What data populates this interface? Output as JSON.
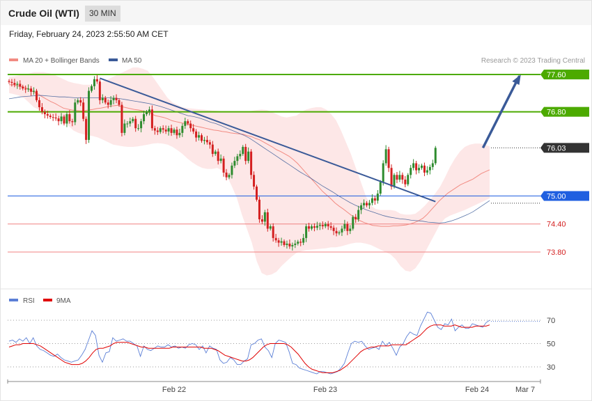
{
  "header": {
    "title": "Crude Oil (WTI)",
    "timeframe": "30 MIN"
  },
  "timestamp": "Friday, February 24, 2023 2:55:50 AM CET",
  "legend": {
    "ma20": {
      "label": "MA 20 + Bollinger Bands",
      "color": "#f28b82"
    },
    "ma50": {
      "label": "MA 50",
      "color": "#3a5a98"
    }
  },
  "credit": "Research © 2023 Trading Central",
  "rsi_legend": {
    "rsi": {
      "label": "RSI",
      "color": "#5b7fd6"
    },
    "ma9": {
      "label": "9MA",
      "color": "#e00000"
    }
  },
  "levels": [
    {
      "value": 77.6,
      "label": "77.60",
      "type": "resistance",
      "color": "#4caa00"
    },
    {
      "value": 76.8,
      "label": "76.80",
      "type": "resistance",
      "color": "#4caa00"
    },
    {
      "value": 76.03,
      "label": "76.03",
      "type": "last",
      "color": "#333333"
    },
    {
      "value": 75.0,
      "label": "75.00",
      "type": "pivot",
      "color": "#1f5fe0"
    },
    {
      "value": 74.4,
      "label": "74.40",
      "type": "support",
      "color": "#f08080"
    },
    {
      "value": 73.8,
      "label": "73.80",
      "type": "support",
      "color": "#f08080"
    }
  ],
  "x_labels": [
    "Feb 22",
    "Feb 23",
    "Feb 24",
    "Mar 7"
  ],
  "rsi_levels": [
    {
      "value": 70,
      "label": "70"
    },
    {
      "value": 50,
      "label": "50"
    },
    {
      "value": 30,
      "label": "30"
    }
  ],
  "chart_data": [
    {
      "type": "candlestick",
      "ylim": [
        73.1,
        77.8
      ],
      "close": [
        77.44,
        77.42,
        77.38,
        77.4,
        77.34,
        77.3,
        77.28,
        77.3,
        77.23,
        77.25,
        77.05,
        76.9,
        76.8,
        76.75,
        76.72,
        76.69,
        76.68,
        76.66,
        76.6,
        76.7,
        76.55,
        76.75,
        76.6,
        76.58,
        77.0,
        77.05,
        77.0,
        76.65,
        76.2,
        77.25,
        77.35,
        77.5,
        77.45,
        77.05,
        77.1,
        77.0,
        76.95,
        77.05,
        77.1,
        77.05,
        76.95,
        76.35,
        76.55,
        76.55,
        76.6,
        76.65,
        76.45,
        76.45,
        76.6,
        76.75,
        76.8,
        76.85,
        76.45,
        76.4,
        76.37,
        76.45,
        76.42,
        76.38,
        76.45,
        76.35,
        76.42,
        76.3,
        76.35,
        76.5,
        76.6,
        76.55,
        76.45,
        76.38,
        76.25,
        76.3,
        76.18,
        76.2,
        76.15,
        76.1,
        75.9,
        75.95,
        75.75,
        75.8,
        75.5,
        75.4,
        75.45,
        75.65,
        75.75,
        75.85,
        75.9,
        76.05,
        75.75,
        75.95,
        75.45,
        75.2,
        74.92,
        74.5,
        74.45,
        74.65,
        74.3,
        74.35,
        74.1,
        74.05,
        74.0,
        74.03,
        73.95,
        73.98,
        73.92,
        73.95,
        73.98,
        74.02,
        74.0,
        74.1,
        74.35,
        74.3,
        74.35,
        74.32,
        74.36,
        74.38,
        74.35,
        74.4,
        74.35,
        74.32,
        74.25,
        74.2,
        74.22,
        74.3,
        74.4,
        74.25,
        74.3,
        74.55,
        74.5,
        74.7,
        74.8,
        74.85,
        74.8,
        74.85,
        74.95,
        74.9,
        75.05,
        75.3,
        75.7,
        76.0,
        75.6,
        75.2,
        75.45,
        75.35,
        75.45,
        75.35,
        75.25,
        75.45,
        75.6,
        75.7,
        75.55,
        75.6,
        75.65,
        75.5,
        75.55,
        75.62,
        75.7,
        76.03
      ],
      "ma20": [
        77.38,
        77.38,
        77.36,
        77.34,
        77.32,
        77.27,
        77.22,
        77.18,
        77.12,
        77.07,
        77.02,
        76.98,
        76.93,
        76.88,
        76.86,
        76.84,
        76.83,
        76.82,
        76.82,
        76.84,
        76.85,
        76.87,
        76.88,
        76.9,
        76.92,
        76.93,
        76.94,
        76.91,
        76.89,
        76.87,
        76.85,
        76.84,
        76.82,
        76.8,
        76.76,
        76.72,
        76.7,
        76.68,
        76.65,
        76.61,
        76.59,
        76.57,
        76.55,
        76.53,
        76.51,
        76.49,
        76.47,
        76.45,
        76.43,
        76.41,
        76.4,
        76.38,
        76.37,
        76.35,
        76.34,
        76.33,
        76.32,
        76.29,
        76.27,
        76.23,
        76.2,
        76.15,
        76.1,
        76.05,
        75.99,
        75.95,
        75.9,
        75.85,
        75.78,
        75.7,
        75.6,
        75.5,
        75.4,
        75.3,
        75.2,
        75.1,
        75.02,
        74.94,
        74.85,
        74.78,
        74.72,
        74.65,
        74.58,
        74.52,
        74.47,
        74.43,
        74.4,
        74.37,
        74.36,
        74.35,
        74.35,
        74.35,
        74.36,
        74.36,
        74.37,
        74.38,
        74.4,
        74.43,
        74.47,
        74.52,
        74.6,
        74.7,
        74.8,
        74.9,
        74.98,
        75.06,
        75.12,
        75.18,
        75.24,
        75.28,
        75.32,
        75.36,
        75.42,
        75.48,
        75.52,
        75.56
      ],
      "bb_upper": [
        77.55,
        77.56,
        77.58,
        77.6,
        77.62,
        77.65,
        77.65,
        77.65,
        77.63,
        77.6,
        77.55,
        77.5,
        77.45,
        77.42,
        77.4,
        77.38,
        77.38,
        77.38,
        77.4,
        77.45,
        77.5,
        77.55,
        77.6,
        77.65,
        77.7,
        77.75,
        77.75,
        77.72,
        77.68,
        77.55,
        77.4,
        77.25,
        77.1,
        77.0,
        76.95,
        76.9,
        76.88,
        76.87,
        76.86,
        76.85,
        76.84,
        76.83,
        76.82,
        76.81,
        76.8,
        76.8,
        76.8,
        76.8,
        76.8,
        76.82,
        76.84,
        76.85,
        76.84,
        76.8,
        76.75,
        76.7,
        76.68,
        76.7,
        76.72,
        76.8,
        76.85,
        76.88,
        76.9,
        76.9,
        76.85,
        76.75,
        76.62,
        76.4,
        76.15,
        75.9,
        75.6,
        75.3,
        75.0,
        74.8,
        74.72,
        74.7,
        74.7,
        74.7,
        74.68,
        74.62,
        74.6,
        74.6,
        74.62,
        74.7,
        74.8,
        74.92,
        75.05,
        75.2,
        75.4,
        75.62,
        75.8,
        75.95,
        76.05,
        76.1,
        76.12,
        76.12,
        76.1,
        76.06
      ],
      "bb_lower": [
        77.2,
        77.18,
        77.15,
        77.1,
        77.0,
        76.9,
        76.85,
        76.8,
        76.75,
        76.72,
        76.7,
        76.62,
        76.5,
        76.4,
        76.35,
        76.32,
        76.3,
        76.28,
        76.25,
        76.2,
        76.15,
        76.1,
        76.08,
        76.06,
        76.05,
        76.05,
        76.06,
        76.08,
        76.1,
        76.12,
        76.13,
        76.12,
        76.1,
        76.05,
        75.98,
        75.9,
        75.8,
        75.72,
        75.65,
        75.6,
        75.58,
        75.58,
        75.6,
        75.55,
        75.42,
        75.2,
        74.95,
        74.6,
        74.3,
        74.0,
        73.6,
        73.35,
        73.3,
        73.32,
        73.38,
        73.5,
        73.6,
        73.7,
        73.78,
        73.82,
        73.84,
        73.85,
        73.86,
        73.87,
        73.88,
        73.9,
        73.9,
        73.92,
        73.95,
        73.98,
        74.0,
        74.0,
        73.98,
        73.95,
        73.9,
        73.85,
        73.8,
        73.75,
        73.65,
        73.5,
        73.4,
        73.38,
        73.45,
        73.6,
        73.8,
        74.0,
        74.2,
        74.4,
        74.52,
        74.58,
        74.62,
        74.66,
        74.7,
        74.75,
        74.8,
        74.85,
        74.9,
        74.95
      ],
      "ma50": [
        77.08,
        77.1,
        77.12,
        77.13,
        77.14,
        77.15,
        77.15,
        77.14,
        77.13,
        77.12,
        77.12,
        77.11,
        77.1,
        77.1,
        77.1,
        77.1,
        77.1,
        77.1,
        77.1,
        77.09,
        77.08,
        77.06,
        77.04,
        77.02,
        77.0,
        76.98,
        76.95,
        76.92,
        76.88,
        76.84,
        76.8,
        76.76,
        76.72,
        76.7,
        76.67,
        76.63,
        76.58,
        76.55,
        76.5,
        76.45,
        76.4,
        76.35,
        76.3,
        76.24,
        76.16,
        76.08,
        76.0,
        75.92,
        75.84,
        75.76,
        75.68,
        75.6,
        75.52,
        75.45,
        75.38,
        75.3,
        75.22,
        75.15,
        75.08,
        75.0,
        74.93,
        74.86,
        74.8,
        74.75,
        74.7,
        74.66,
        74.62,
        74.58,
        74.55,
        74.53,
        74.51,
        74.5,
        74.48,
        74.47,
        74.46,
        74.44,
        74.43,
        74.42,
        74.43,
        74.46,
        74.5,
        74.55,
        74.6,
        74.66,
        74.74,
        74.82,
        74.9
      ],
      "trendline": [
        {
          "i": 33,
          "v": 77.52
        },
        {
          "i": 155,
          "v": 74.88
        }
      ],
      "target_arrow": [
        {
          "i": 171,
          "v": 76.03
        },
        {
          "i": 185,
          "v": 77.6
        }
      ]
    },
    {
      "type": "line",
      "title": "RSI",
      "ylim": [
        20,
        80
      ],
      "rsi": [
        52,
        53,
        51,
        54,
        52,
        55,
        50,
        55,
        48,
        45,
        44,
        42,
        40,
        39,
        41,
        38,
        36,
        35,
        34,
        35,
        36,
        40,
        45,
        53,
        61,
        57,
        40,
        34,
        42,
        43,
        55,
        52,
        53,
        54,
        52,
        52,
        50,
        48,
        39,
        48,
        45,
        44,
        46,
        48,
        47,
        47,
        49,
        47,
        48,
        46,
        47,
        46,
        49,
        50,
        49,
        45,
        48,
        42,
        48,
        46,
        45,
        36,
        33,
        34,
        38,
        36,
        32,
        32,
        35,
        37,
        49,
        50,
        53,
        54,
        47,
        44,
        38,
        50,
        53,
        52,
        51,
        43,
        33,
        32,
        29,
        28,
        27,
        26,
        25,
        24,
        26,
        26,
        25,
        24,
        25,
        26,
        29,
        33,
        42,
        50,
        52,
        51,
        52,
        48,
        45,
        46,
        47,
        45,
        52,
        48,
        51,
        46,
        40,
        47,
        50,
        56,
        60,
        58,
        57,
        65,
        71,
        77,
        76,
        70,
        64,
        62,
        67,
        66,
        71,
        61,
        64,
        66,
        63,
        63,
        67,
        66,
        65,
        64,
        68,
        70
      ],
      "ma9": [
        47,
        48,
        49,
        49,
        50,
        50,
        50,
        50,
        49,
        48,
        46,
        44,
        42,
        40,
        38,
        36,
        34,
        33,
        32,
        32,
        32,
        33,
        35,
        38,
        42,
        45,
        46,
        46,
        47,
        48,
        50,
        51,
        51,
        51,
        51,
        50,
        49,
        48,
        47,
        47,
        46,
        46,
        46,
        46,
        46,
        46,
        46,
        47,
        47,
        47,
        47,
        47,
        47,
        47,
        47,
        47,
        46,
        46,
        46,
        45,
        44,
        42,
        40,
        39,
        38,
        37,
        36,
        35,
        35,
        36,
        38,
        41,
        44,
        47,
        49,
        50,
        50,
        50,
        50,
        50,
        49,
        47,
        44,
        41,
        37,
        33,
        30,
        28,
        27,
        26,
        25,
        25,
        25,
        25,
        26,
        27,
        29,
        31,
        34,
        37,
        40,
        43,
        45,
        46,
        47,
        47,
        48,
        48,
        48,
        48,
        49,
        49,
        49,
        49,
        49,
        51,
        53,
        55,
        57,
        60,
        63,
        65,
        66,
        66,
        66,
        65,
        65,
        65,
        66,
        65,
        64,
        64,
        64,
        64,
        65,
        65,
        65,
        65,
        66
      ]
    }
  ]
}
